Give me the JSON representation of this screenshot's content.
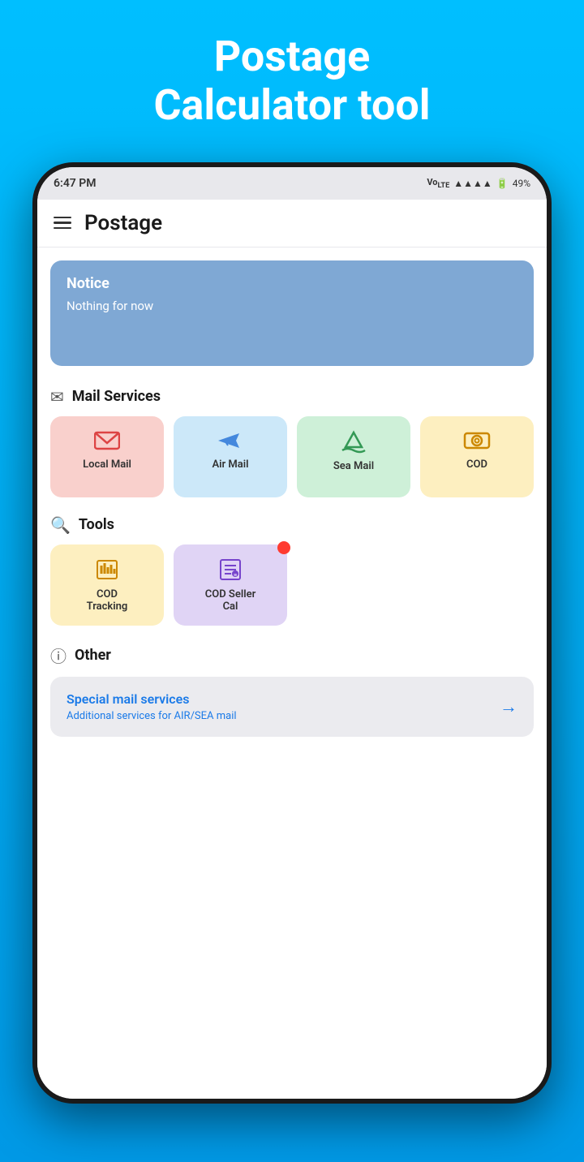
{
  "appTitle": {
    "line1": "Postage",
    "line2": "Calculator tool"
  },
  "statusBar": {
    "time": "6:47 PM",
    "battery": "49%"
  },
  "header": {
    "title": "Postage",
    "menuLabel": "menu"
  },
  "notice": {
    "title": "Notice",
    "body": "Nothing for now"
  },
  "mailServices": {
    "sectionTitle": "Mail Services",
    "items": [
      {
        "id": "local-mail",
        "label": "Local Mail",
        "colorClass": "local"
      },
      {
        "id": "air-mail",
        "label": "Air Mail",
        "colorClass": "air"
      },
      {
        "id": "sea-mail",
        "label": "Sea Mail",
        "colorClass": "sea"
      },
      {
        "id": "cod",
        "label": "COD",
        "colorClass": "cod"
      }
    ]
  },
  "tools": {
    "sectionTitle": "Tools",
    "items": [
      {
        "id": "cod-tracking",
        "label": "COD\nTracking",
        "colorClass": "cod-tracking",
        "hasNotification": false
      },
      {
        "id": "cod-seller-cal",
        "label": "COD Seller\nCal",
        "colorClass": "cod-seller",
        "hasNotification": true
      }
    ]
  },
  "other": {
    "sectionTitle": "Other",
    "card": {
      "title": "Special mail services",
      "subtitle": "Additional services for AIR/SEA mail"
    }
  }
}
